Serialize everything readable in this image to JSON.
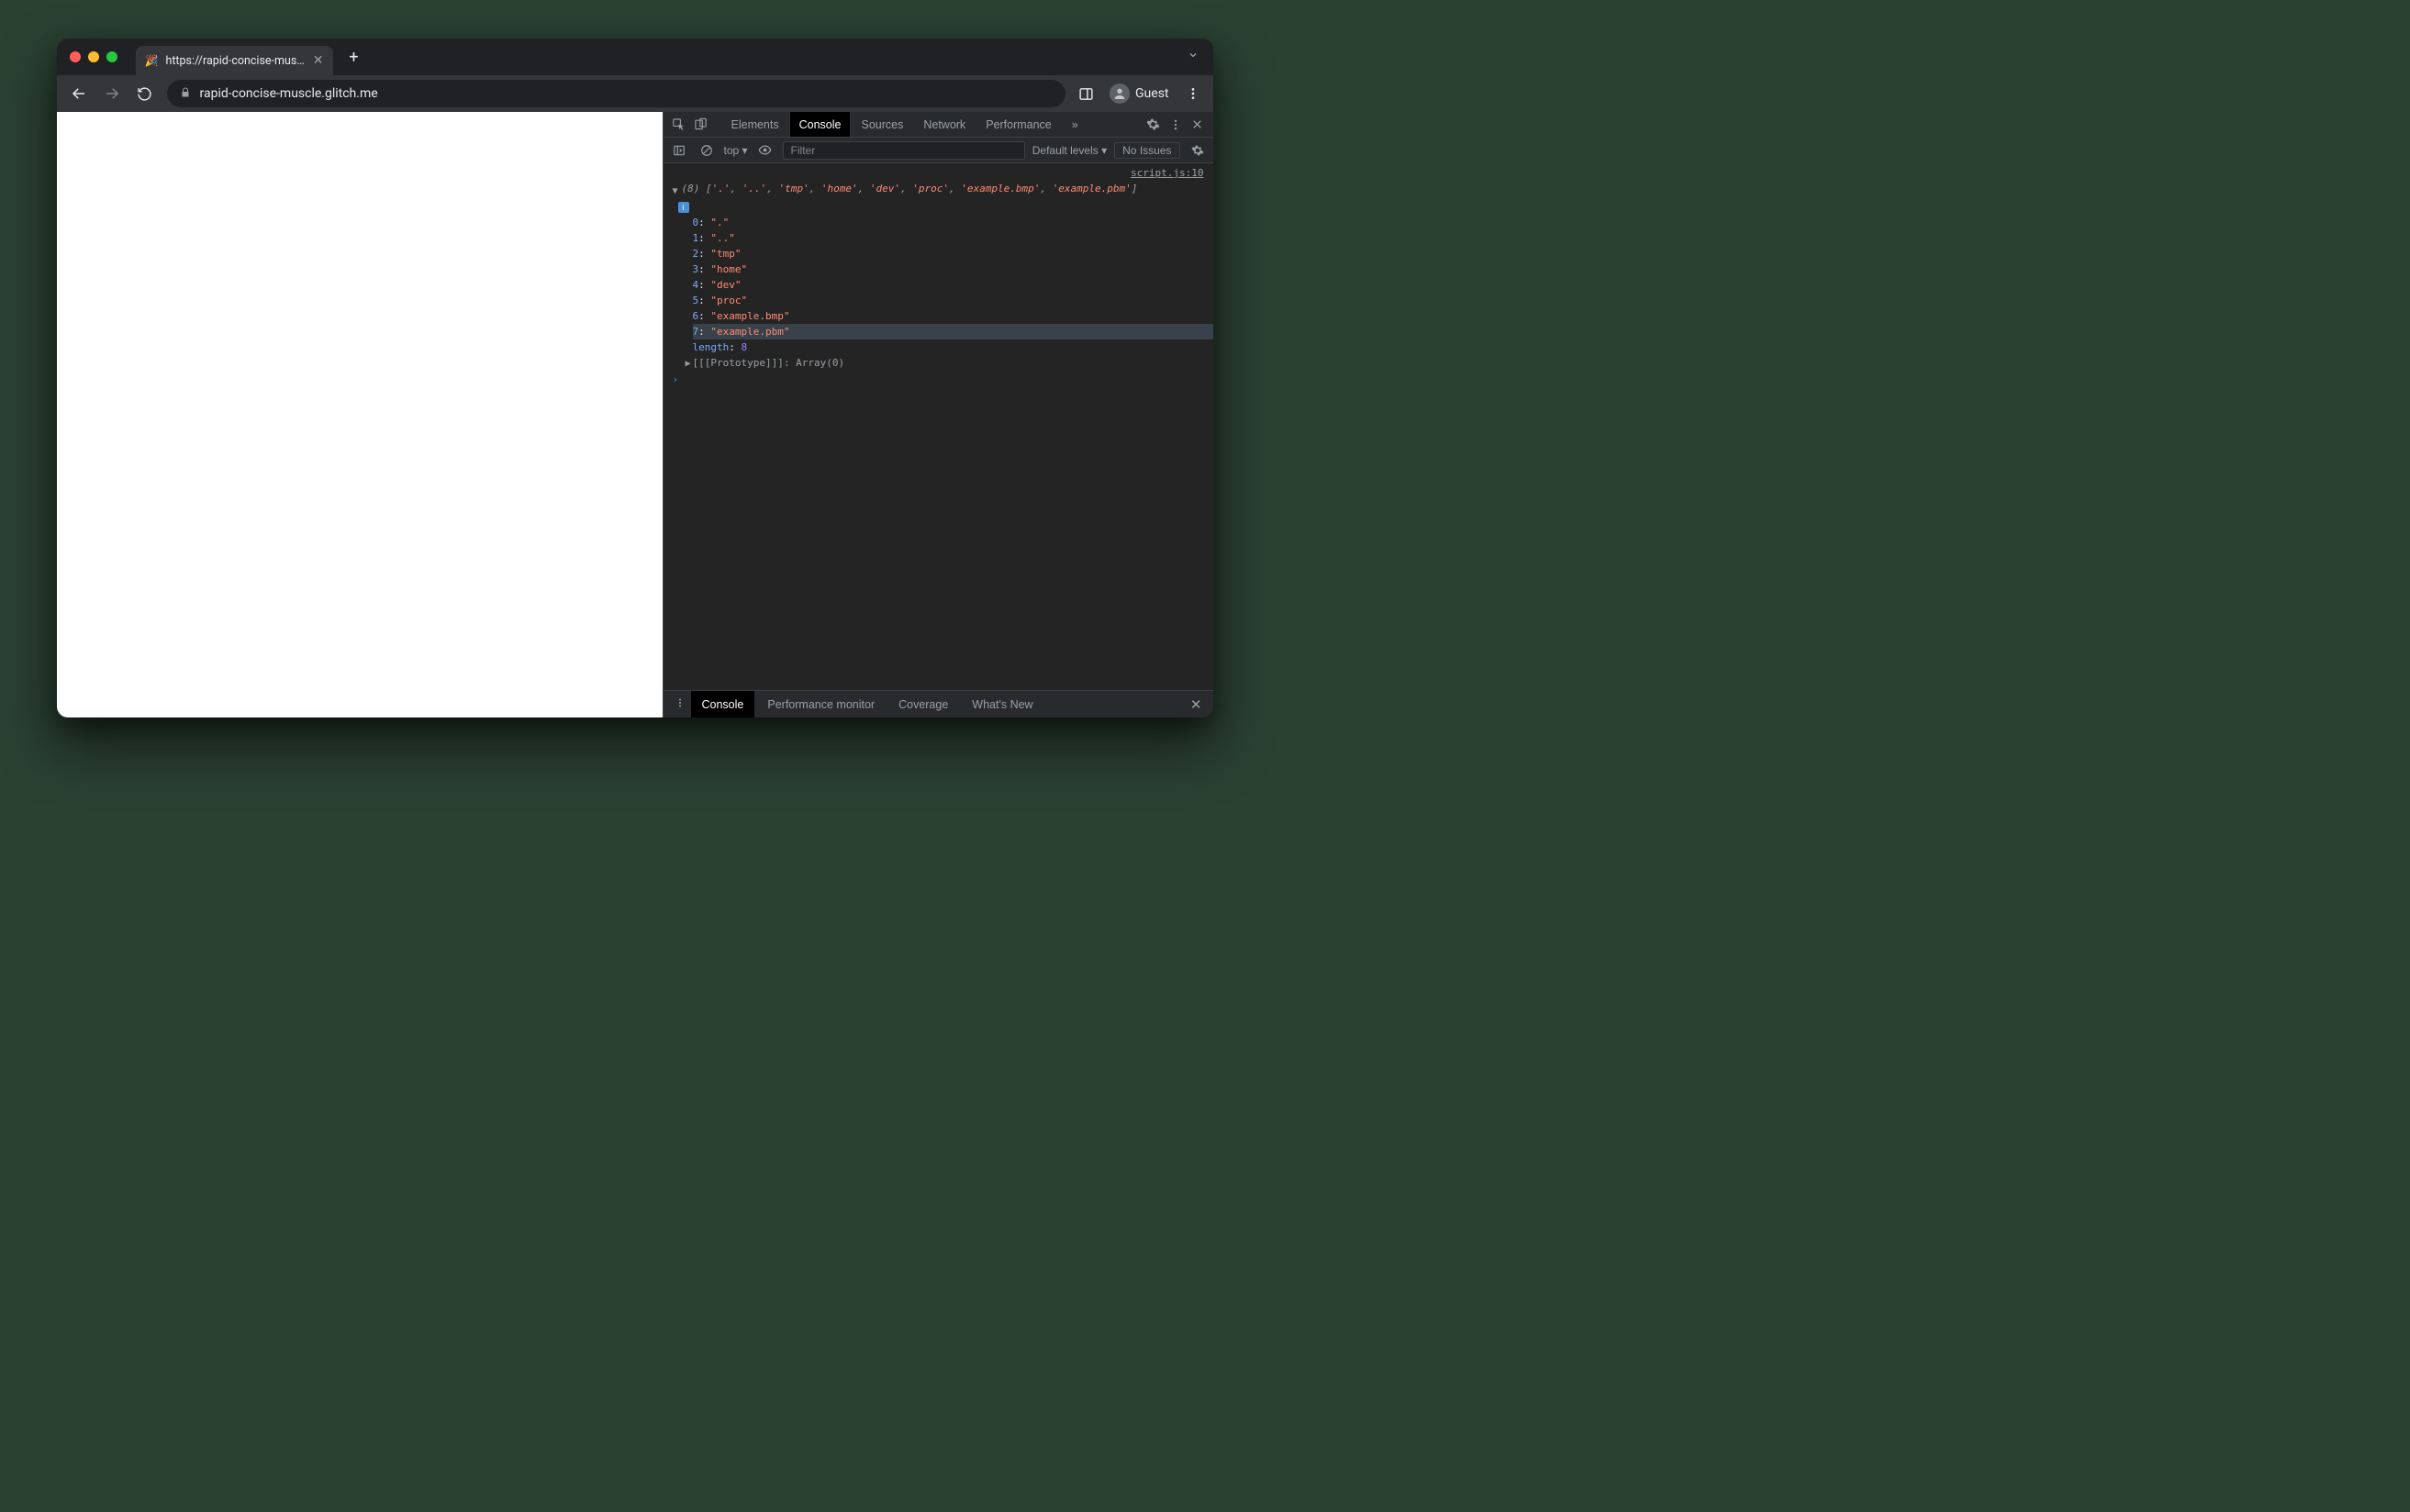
{
  "tab": {
    "favicon": "🎉",
    "title": "https://rapid-concise-muscle.g"
  },
  "toolbar": {
    "url": "rapid-concise-muscle.glitch.me",
    "guest": "Guest"
  },
  "devtools": {
    "tabs": [
      "Elements",
      "Console",
      "Sources",
      "Network",
      "Performance"
    ],
    "active_tab": "Console",
    "more": "»"
  },
  "console_bar": {
    "context": "top ▾",
    "filter_placeholder": "Filter",
    "levels": "Default levels ▾",
    "issues": "No Issues"
  },
  "source_link": "script.js:10",
  "array": {
    "count": "(8)",
    "inline": [
      "'.'",
      "'..'",
      "'tmp'",
      "'home'",
      "'dev'",
      "'proc'",
      "'example.bmp'",
      "'example.pbm'"
    ],
    "items": [
      {
        "i": "0",
        "v": "\".\""
      },
      {
        "i": "1",
        "v": "\"..\""
      },
      {
        "i": "2",
        "v": "\"tmp\""
      },
      {
        "i": "3",
        "v": "\"home\""
      },
      {
        "i": "4",
        "v": "\"dev\""
      },
      {
        "i": "5",
        "v": "\"proc\""
      },
      {
        "i": "6",
        "v": "\"example.bmp\""
      },
      {
        "i": "7",
        "v": "\"example.pbm\"",
        "hl": true
      }
    ],
    "length_k": "length",
    "length_v": "8",
    "proto_label": "[[Prototype]]",
    "proto_value": "Array(0)"
  },
  "drawer": {
    "tabs": [
      "Console",
      "Performance monitor",
      "Coverage",
      "What's New"
    ],
    "active": "Console"
  }
}
